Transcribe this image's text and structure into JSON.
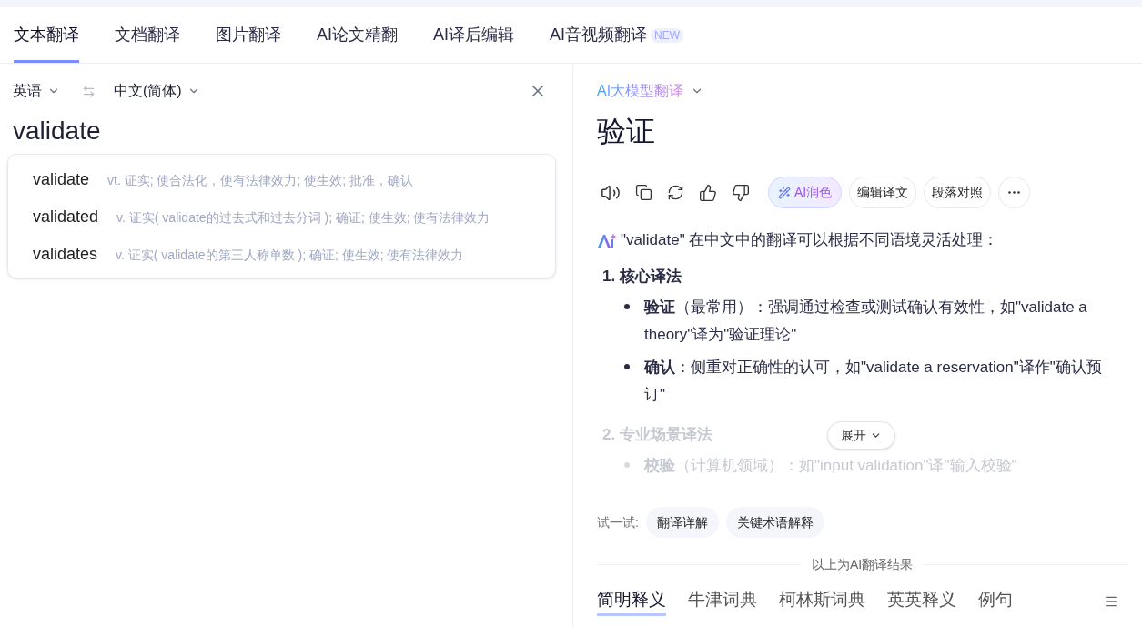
{
  "top_tabs": [
    {
      "label": "文本翻译",
      "selected": true
    },
    {
      "label": "文档翻译",
      "selected": false
    },
    {
      "label": "图片翻译",
      "selected": false
    },
    {
      "label": "AI论文精翻",
      "selected": false
    },
    {
      "label": "AI译后编辑",
      "selected": false
    },
    {
      "label": "AI音视频翻译",
      "selected": false,
      "badge": "NEW"
    }
  ],
  "source_language": "英语",
  "target_language": "中文(简体)",
  "input": {
    "value": "validate"
  },
  "suggestions": [
    {
      "word": "validate",
      "definition": "vt. 证实; 使合法化，使有法律效力; 使生效; 批准，确认"
    },
    {
      "word": "validated",
      "definition": "v. 证实( validate的过去式和过去分词 ); 确证; 使生效; 使有法律效力"
    },
    {
      "word": "validates",
      "definition": "v. 证实( validate的第三人称单数 ); 确证; 使生效; 使有法律效力"
    }
  ],
  "model_selector": "AI大模型翻译",
  "result": "验证",
  "chips": [
    {
      "kind": "ai",
      "label": "AI润色"
    },
    {
      "kind": "plain",
      "label": "编辑译文"
    },
    {
      "kind": "plain",
      "label": "段落对照"
    }
  ],
  "explanation": {
    "intro": "\"validate\" 在中文中的翻译可以根据不同语境灵活处理：",
    "sections": [
      {
        "title": "1. 核心译法",
        "faded": false,
        "items": [
          "**验证**（最常用）：强调通过检查或测试确认有效性，如\"validate a theory\"译为\"验证理论\"",
          "**确认**：侧重对正确性的认可，如\"validate a reservation\"译作\"确认预订\""
        ]
      },
      {
        "title": "2. 专业场景译法",
        "faded": true,
        "items": [
          "**校验**（计算机领域）：如\"input validation\"译\"输入校验\""
        ]
      }
    ]
  },
  "expand_button": "展开",
  "try": {
    "label": "试一试:",
    "chips": [
      "翻译详解",
      "关键术语解释"
    ]
  },
  "divider_text": "以上为AI翻译结果",
  "dict_tabs": [
    {
      "label": "简明释义",
      "selected": true
    },
    {
      "label": "牛津词典",
      "selected": false
    },
    {
      "label": "柯林斯词典",
      "selected": false
    },
    {
      "label": "英英释义",
      "selected": false
    },
    {
      "label": "例句",
      "selected": false
    }
  ]
}
